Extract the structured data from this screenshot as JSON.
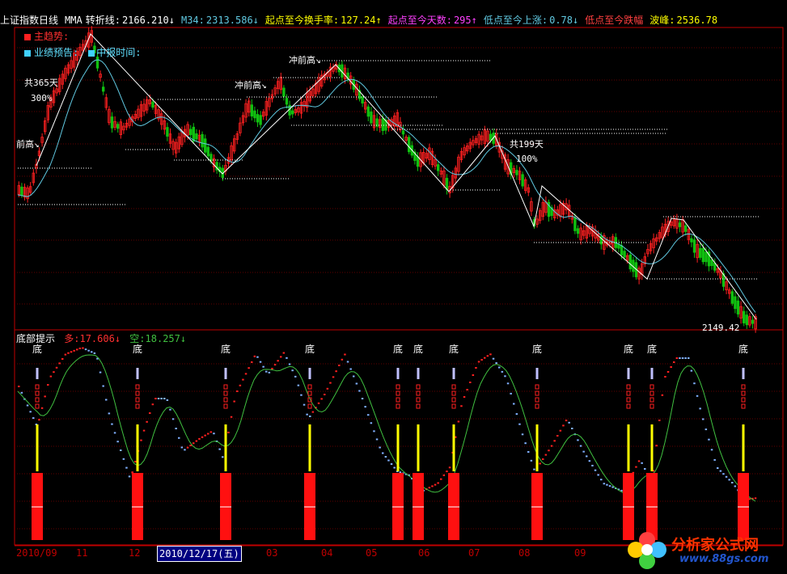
{
  "topbar": {
    "index_label": "上证指数日线",
    "ma_label": "MMA",
    "turn_label": "转折线:",
    "turn_value": "2166.210↓",
    "m34_label": "M34:",
    "m34_value": "2313.586↓",
    "start_to_now_label": "起点至今换手率:",
    "start_to_now_value": "127.24↑",
    "days_label": "起点至今天数:",
    "days_value": "295↑",
    "low_label": "低点至今上涨:",
    "low_value": "0.78↓",
    "low2_label": "低点至今跌幅",
    "wave_label": "波峰:",
    "wave_value": "2536.78"
  },
  "legend": {
    "main_force": "主趋势:",
    "performance": "业绩预告:",
    "report_time": "中报时间:"
  },
  "main_annotations": {
    "days_365": "共365天",
    "pct_300": "300%",
    "prev_high_left": "前高↘",
    "prev_high_1": "冲前高↘",
    "prev_high_2": "冲前高↘",
    "days_199": "共199天",
    "pct_100": "100%",
    "last_price": "2149.42"
  },
  "sub_panel": {
    "title": "底部提示",
    "duo_label": "多:",
    "duo_value": "17.606↓",
    "kong_label": "空:",
    "kong_value": "18.257↓",
    "bottom_marker": "底"
  },
  "axis": {
    "labels": [
      "2010/09",
      "11",
      "12",
      "03",
      "04",
      "05",
      "06",
      "07",
      "08",
      "09"
    ],
    "selected_date": "2010/12/17(五)"
  },
  "watermark": {
    "title": "分析家公式网",
    "url": "www.88gs.com"
  },
  "colors": {
    "bg": "#000000",
    "grid": "#c00000",
    "up": "#ff2020",
    "down": "#10c010",
    "ma_line": "#60c8e0",
    "trend_line": "#ffffff",
    "marker_yellow": "#ffff00",
    "signal_blue": "#c0c0ff",
    "sub_green": "#40c040"
  }
}
